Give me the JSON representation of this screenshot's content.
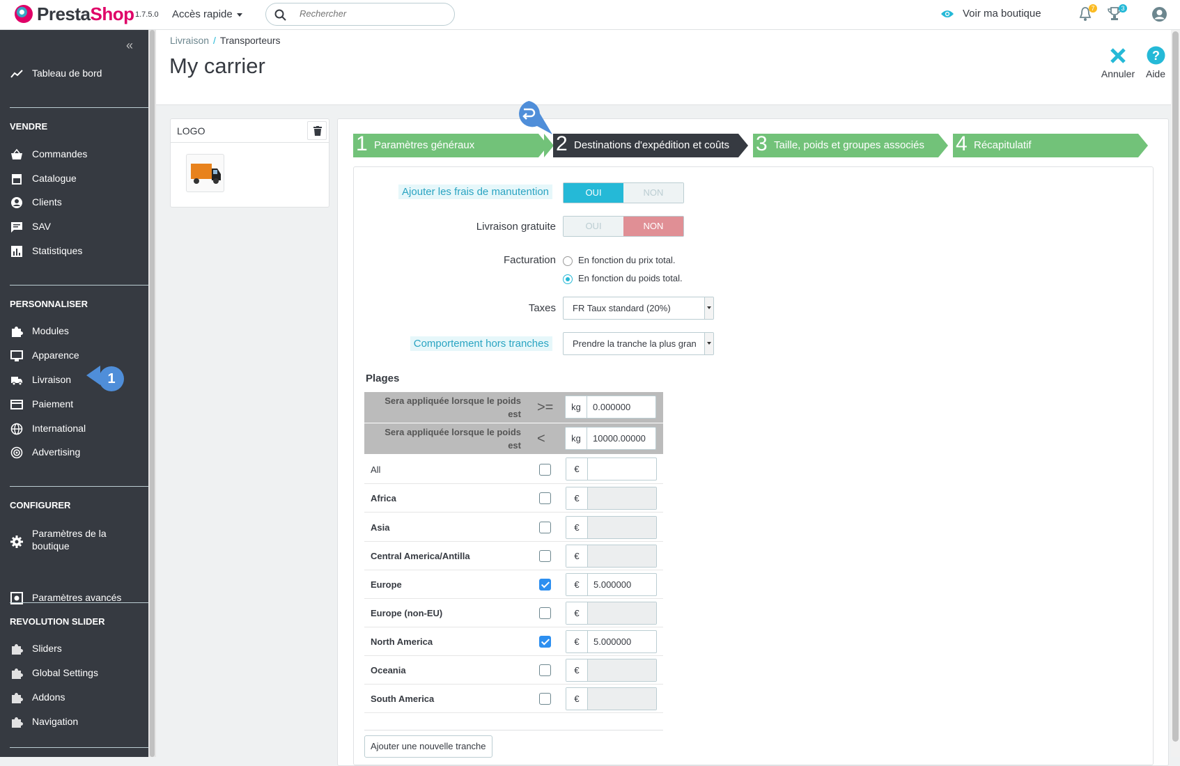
{
  "topbar": {
    "brand_main": "Presta",
    "brand_accent": "Shop",
    "version": "1.7.5.0",
    "quick_access": "Accès rapide",
    "search_placeholder": "Rechercher",
    "view_shop": "Voir ma boutique",
    "notif_count_1": "7",
    "notif_count_2": "3"
  },
  "sidebar": {
    "dashboard": "Tableau de bord",
    "sections": [
      {
        "title": "VENDRE",
        "items": [
          "Commandes",
          "Catalogue",
          "Clients",
          "SAV",
          "Statistiques"
        ]
      },
      {
        "title": "PERSONNALISER",
        "items": [
          "Modules",
          "Apparence",
          "Livraison",
          "Paiement",
          "International",
          "Advertising"
        ]
      },
      {
        "title": "CONFIGURER",
        "items": [
          "Paramètres de la boutique",
          "Paramètres avancés"
        ]
      },
      {
        "title": "REVOLUTION SLIDER",
        "items": [
          "Sliders",
          "Global Settings",
          "Addons",
          "Navigation"
        ]
      }
    ],
    "callout": "1"
  },
  "header": {
    "breadcrumb_parent": "Livraison",
    "breadcrumb_sep": "/",
    "breadcrumb_current": "Transporteurs",
    "title": "My carrier",
    "cancel": "Annuler",
    "help": "Aide"
  },
  "logo_panel": {
    "title": "LOGO"
  },
  "wizard": {
    "steps": [
      {
        "num": "1",
        "label": "Paramètres généraux"
      },
      {
        "num": "2",
        "label": "Destinations d'expédition et coûts"
      },
      {
        "num": "3",
        "label": "Taille, poids et groupes associés"
      },
      {
        "num": "4",
        "label": "Récapitulatif"
      }
    ],
    "callout_icon": "undo-arrow-icon",
    "colors": {
      "done": "#72c279",
      "active": "#363a41",
      "switch_on": "#25b9d7",
      "switch_no": "#e08f95"
    }
  },
  "form": {
    "handling_label": "Ajouter les frais de manutention",
    "handling_yes": "OUI",
    "handling_no": "NON",
    "free_label": "Livraison gratuite",
    "free_yes": "OUI",
    "free_no": "NON",
    "billing_label": "Facturation",
    "billing_opt1": "En fonction du prix total.",
    "billing_opt2": "En fonction du poids total.",
    "taxes_label": "Taxes",
    "taxes_value": "FR Taux standard (20%)",
    "out_of_range_label": "Comportement hors tranches",
    "out_of_range_value": "Prendre la tranche la plus gran"
  },
  "ranges": {
    "title": "Plages",
    "row1_label": "Sera appliquée lorsque le poids est",
    "row1_op": ">=",
    "row1_unit": "kg",
    "row1_value": "0.000000",
    "row2_label": "Sera appliquée lorsque le poids est",
    "row2_op": "<",
    "row2_unit": "kg",
    "row2_value": "10000.00000",
    "currency": "€",
    "zones": [
      {
        "name": "All",
        "checked": false,
        "value": ""
      },
      {
        "name": "Africa",
        "checked": false,
        "value": ""
      },
      {
        "name": "Asia",
        "checked": false,
        "value": ""
      },
      {
        "name": "Central America/Antilla",
        "checked": false,
        "value": ""
      },
      {
        "name": "Europe",
        "checked": true,
        "value": "5.000000"
      },
      {
        "name": "Europe (non-EU)",
        "checked": false,
        "value": ""
      },
      {
        "name": "North America",
        "checked": true,
        "value": "5.000000"
      },
      {
        "name": "Oceania",
        "checked": false,
        "value": ""
      },
      {
        "name": "South America",
        "checked": false,
        "value": ""
      }
    ],
    "add_range": "Ajouter une nouvelle tranche"
  }
}
